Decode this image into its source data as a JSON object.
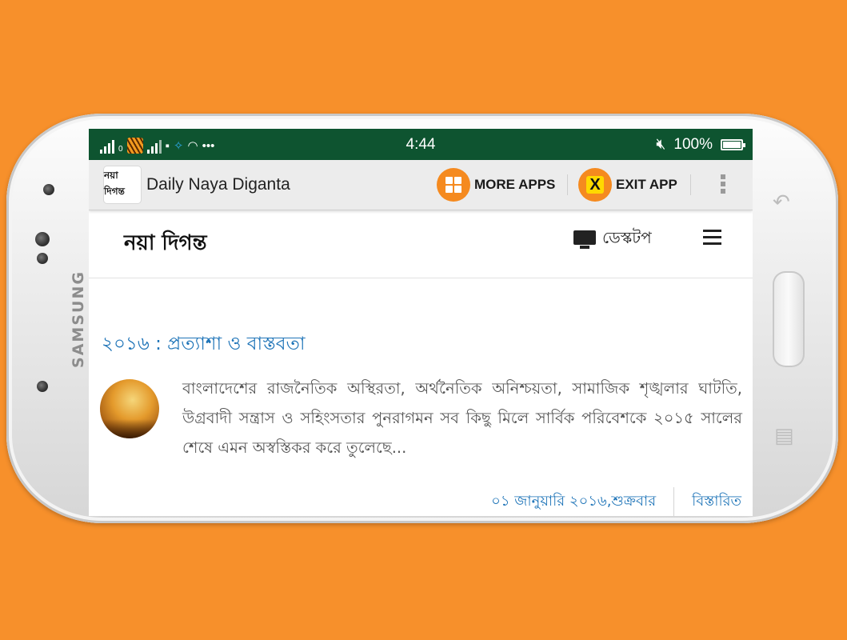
{
  "device": {
    "brand": "SAMSUNG"
  },
  "status_bar": {
    "sim_label": "0",
    "time": "4:44",
    "battery": "100%",
    "overflow": "•••"
  },
  "app_bar": {
    "logo_text": "নয়া দিগন্ত",
    "title": "Daily Naya Diganta",
    "more_apps_label": "MORE APPS",
    "exit_app_label": "EXIT APP",
    "exit_icon_glyph": "X"
  },
  "site": {
    "logo_text": "নয়া দিগন্ত",
    "desktop_label": "ডেস্কটপ"
  },
  "article": {
    "title": "২০১৬ : প্রত্যাশা ও বাস্তবতা",
    "excerpt": "বাংলাদেশের রাজনৈতিক অস্থিরতা, অর্থনৈতিক অনিশ্চয়তা, সামাজিক শৃঙ্খলার ঘাটতি, উগ্রবাদী সন্ত্রাস ও সহিংসতার পুনরাগমন সব কিছু মিলে সার্বিক পরিবেশকে ২০১৫ সালের শেষে এমন অস্বস্তিকর করে তুলেছে...",
    "date": "০১ জানুয়ারি ২০১৬,শুক্রবার",
    "details_label": "বিস্তারিত"
  },
  "colors": {
    "background": "#f7902b",
    "status_bar": "#0e5430",
    "accent_orange": "#f58a1f",
    "link_blue": "#1e74b8"
  }
}
